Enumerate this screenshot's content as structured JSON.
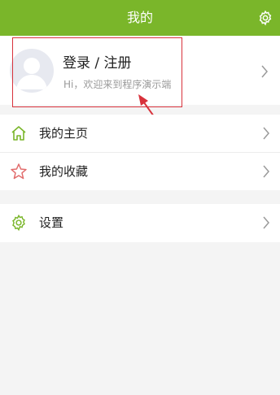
{
  "header": {
    "title": "我的",
    "settings_icon": "gear-icon"
  },
  "profile": {
    "name": "登录 / 注册",
    "subtitle": "Hi，欢迎来到程序演示端",
    "avatar_icon": "user-avatar-icon"
  },
  "menu": {
    "homepage": {
      "label": "我的主页",
      "icon": "home-icon"
    },
    "favorites": {
      "label": "我的收藏",
      "icon": "star-icon"
    },
    "settings": {
      "label": "设置",
      "icon": "gear-icon"
    }
  },
  "colors": {
    "accent": "#7ab62a",
    "annotation": "#d8323c",
    "home_icon": "#7ab62a",
    "star_icon": "#e26d6d",
    "settings_icon": "#7ab62a"
  }
}
